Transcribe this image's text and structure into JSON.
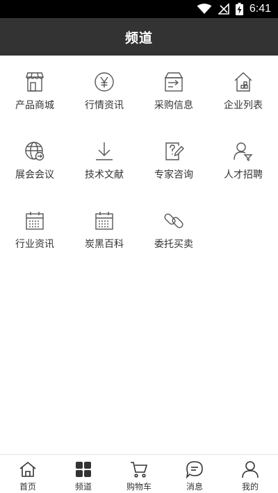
{
  "status_bar": {
    "time": "6:41",
    "icons": [
      "wifi-icon",
      "no-signal-icon",
      "battery-charging-icon"
    ]
  },
  "header": {
    "title": "频道"
  },
  "channels": [
    {
      "label": "产品商城",
      "icon": "store-icon"
    },
    {
      "label": "行情资讯",
      "icon": "yen-coin-icon"
    },
    {
      "label": "采购信息",
      "icon": "purchase-box-icon"
    },
    {
      "label": "企业列表",
      "icon": "company-house-icon"
    },
    {
      "label": "展会会议",
      "icon": "globe-arrow-icon"
    },
    {
      "label": "技术文献",
      "icon": "download-icon"
    },
    {
      "label": "专家咨询",
      "icon": "question-document-icon"
    },
    {
      "label": "人才招聘",
      "icon": "person-filter-icon"
    },
    {
      "label": "行业资讯",
      "icon": "calendar-icon"
    },
    {
      "label": "炭黑百科",
      "icon": "calendar-icon"
    },
    {
      "label": "委托买卖",
      "icon": "chain-link-icon"
    }
  ],
  "tab_bar": {
    "items": [
      {
        "label": "首页",
        "icon": "home-icon"
      },
      {
        "label": "频道",
        "icon": "grid-icon"
      },
      {
        "label": "购物车",
        "icon": "cart-icon"
      },
      {
        "label": "消息",
        "icon": "message-icon"
      },
      {
        "label": "我的",
        "icon": "user-icon"
      }
    ]
  },
  "colors": {
    "header_bg": "#333333",
    "status_bg": "#000000",
    "icon_stroke": "#555555",
    "text": "#333333"
  }
}
